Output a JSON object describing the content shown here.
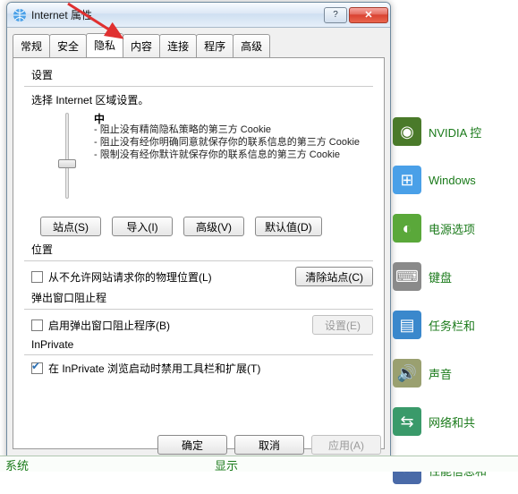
{
  "dialog": {
    "title": "Internet 属性",
    "tabs": [
      "常规",
      "安全",
      "隐私",
      "内容",
      "连接",
      "程序",
      "高级"
    ],
    "active_tab_index": 2,
    "settings": {
      "group_title": "设置",
      "desc": "选择 Internet 区域设置。",
      "level": "中",
      "bullets": [
        "- 阻止没有精简隐私策略的第三方 Cookie",
        "- 阻止没有经你明确同意就保存你的联系信息的第三方 Cookie",
        "- 限制没有经你默许就保存你的联系信息的第三方 Cookie"
      ],
      "buttons": {
        "sites": "站点(S)",
        "import": "导入(I)",
        "advanced": "高级(V)",
        "default": "默认值(D)"
      }
    },
    "location": {
      "group_title": "位置",
      "checkbox_label": "从不允许网站请求你的物理位置(L)",
      "clear_btn": "清除站点(C)"
    },
    "popup": {
      "group_title": "弹出窗口阻止程",
      "checkbox_label": "启用弹出窗口阻止程序(B)",
      "settings_btn": "设置(E)"
    },
    "inprivate": {
      "group_title": "InPrivate",
      "checkbox_label": "在 InPrivate 浏览启动时禁用工具栏和扩展(T)"
    },
    "dlg_buttons": {
      "ok": "确定",
      "cancel": "取消",
      "apply": "应用(A)"
    }
  },
  "cp_items": [
    {
      "label": "NVIDIA 控",
      "bg": "#4a7a2a"
    },
    {
      "label": "Windows",
      "bg": "#4aa0e8"
    },
    {
      "label": "电源选项",
      "bg": "#5aa83a"
    },
    {
      "label": "键盘",
      "bg": "#8a8a8a"
    },
    {
      "label": "任务栏和",
      "bg": "#3a88cc"
    },
    {
      "label": "声音",
      "bg": "#9aa070"
    },
    {
      "label": "网络和共",
      "bg": "#3a9a6a"
    },
    {
      "label": "性能信息和",
      "bg": "#4a6aa8"
    }
  ],
  "bottom": {
    "left": "系统",
    "right": "显示"
  }
}
